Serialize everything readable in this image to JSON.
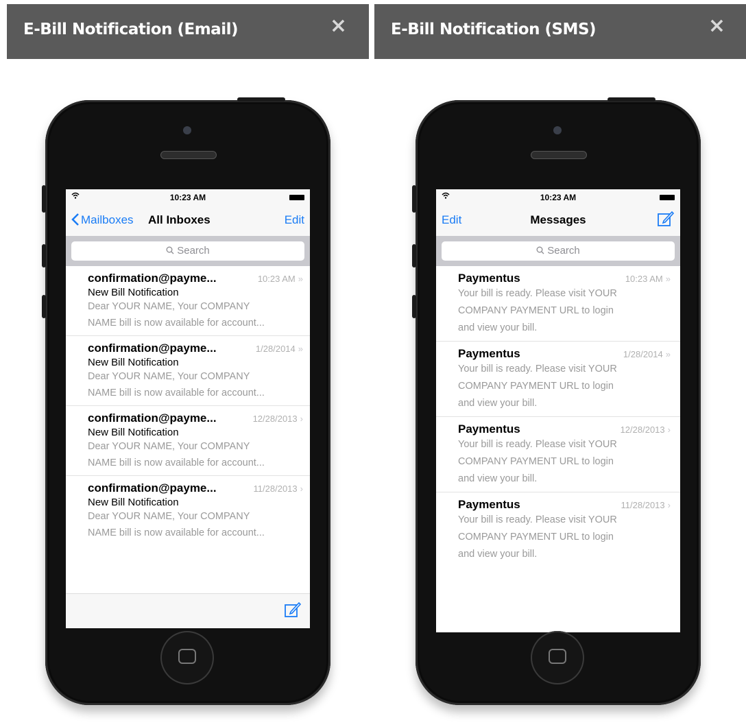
{
  "email_panel": {
    "title": "E-Bill Notification (Email)",
    "close_label": "×",
    "status": {
      "time": "10:23 AM"
    },
    "nav": {
      "back_label": "Mailboxes",
      "title": "All Inboxes",
      "edit_label": "Edit"
    },
    "search_placeholder": "Search",
    "messages": [
      {
        "from": "confirmation@payme...",
        "date": "10:23 AM",
        "chevron": "»",
        "subject": "New Bill Notification",
        "preview1": "Dear YOUR NAME, Your COMPANY",
        "preview2": "NAME bill is now available for account..."
      },
      {
        "from": "confirmation@payme...",
        "date": "1/28/2014",
        "chevron": "»",
        "subject": "New Bill Notification",
        "preview1": "Dear YOUR NAME, Your COMPANY",
        "preview2": "NAME bill is now available for account..."
      },
      {
        "from": "confirmation@payme...",
        "date": "12/28/2013",
        "chevron": "›",
        "subject": "New Bill Notification",
        "preview1": "Dear YOUR NAME, Your COMPANY",
        "preview2": "NAME bill is now available for account..."
      },
      {
        "from": "confirmation@payme...",
        "date": "11/28/2013",
        "chevron": "›",
        "subject": "New Bill Notification",
        "preview1": "Dear YOUR NAME, Your COMPANY",
        "preview2": "NAME bill is now available for account..."
      }
    ]
  },
  "sms_panel": {
    "title": "E-Bill Notification (SMS)",
    "close_label": "×",
    "status": {
      "time": "10:23 AM"
    },
    "nav": {
      "edit_label": "Edit",
      "title": "Messages"
    },
    "search_placeholder": "Search",
    "messages": [
      {
        "from": "Paymentus",
        "date": "10:23 AM",
        "chevron": "»",
        "line1": "Your bill is ready. Please visit YOUR",
        "line2": "COMPANY PAYMENT URL to login",
        "line3": "and view your bill."
      },
      {
        "from": "Paymentus",
        "date": "1/28/2014",
        "chevron": "»",
        "line1": "Your bill is ready. Please visit YOUR",
        "line2": "COMPANY PAYMENT URL to login",
        "line3": "and view your bill."
      },
      {
        "from": "Paymentus",
        "date": "12/28/2013",
        "chevron": "›",
        "line1": "Your bill is ready. Please visit YOUR",
        "line2": "COMPANY PAYMENT URL to login",
        "line3": "and view your bill."
      },
      {
        "from": "Paymentus",
        "date": "11/28/2013",
        "chevron": "›",
        "line1": "Your bill is ready. Please visit YOUR",
        "line2": "COMPANY PAYMENT URL to login",
        "line3": "and view your bill."
      }
    ]
  },
  "colors": {
    "header_bg": "#5a5a5a",
    "ios_blue": "#1a7cf5",
    "phone_body": "#111111"
  },
  "icons": {
    "close": "close-icon",
    "compose": "compose-icon",
    "back": "chevron-left-icon",
    "search": "search-icon",
    "wifi": "wifi-icon",
    "battery": "battery-icon",
    "home": "home-button-icon"
  }
}
